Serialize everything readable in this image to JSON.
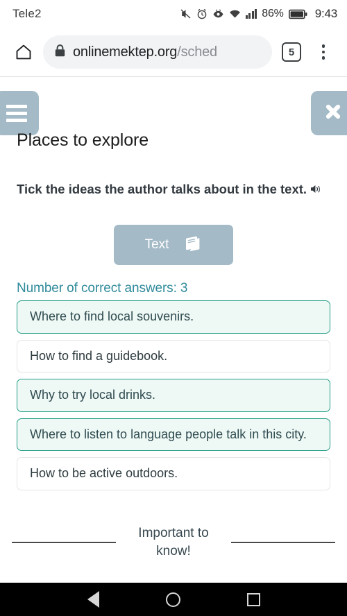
{
  "status_bar": {
    "carrier": "Tele2",
    "battery_percent": "86%",
    "clock": "9:43",
    "icons": [
      "mute-icon",
      "alarm-icon",
      "eye-care-icon",
      "wifi-icon",
      "signal-icon",
      "battery-icon"
    ]
  },
  "browser": {
    "home_icon": "home-icon",
    "lock_icon": "lock-icon",
    "url_domain": "onlinemektep.org",
    "url_path": "/sched",
    "tab_count": "5",
    "menu_icon": "kebab-menu-icon"
  },
  "page": {
    "menu_button_icon": "hamburger-menu-icon",
    "close_button_icon": "close-x-icon",
    "title": "Places to explore",
    "prompt": "Tick the ideas the author talks about in the text.",
    "audio_icon": "speaker-audio-icon",
    "text_button_label": "Text",
    "text_button_icon": "book-icon",
    "correct_answers_text": "Number of correct answers: 3",
    "options": [
      {
        "label": "Where to find local souvenirs.",
        "selected": true
      },
      {
        "label": "How to find a guidebook.",
        "selected": false
      },
      {
        "label": "Why to try local drinks.",
        "selected": true
      },
      {
        "label": "Where to listen to language people talk in this city.",
        "selected": true
      },
      {
        "label": "How to be active outdoors.",
        "selected": false
      }
    ],
    "footer_text": "Important to know!"
  },
  "nav_bar": {
    "back_icon": "back-triangle-icon",
    "home_icon": "home-circle-icon",
    "recents_icon": "recents-square-icon"
  },
  "colors": {
    "accent_teal": "#249e86",
    "accent_blue_text": "#2f8a9b",
    "button_gray_blue": "#a4bac7",
    "selected_bg": "#eef8f4"
  }
}
